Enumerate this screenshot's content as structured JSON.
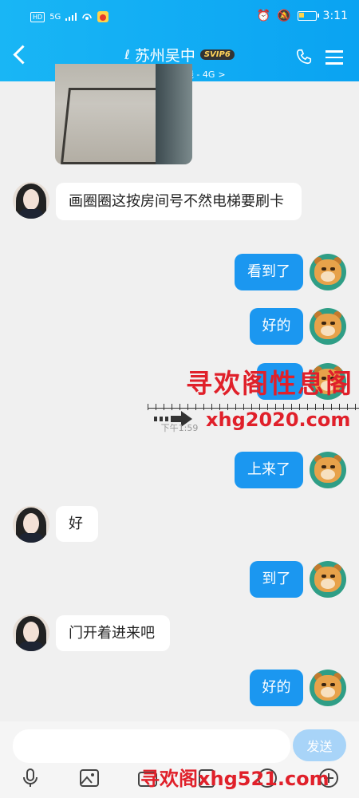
{
  "status_bar": {
    "left_badges": [
      "HD",
      "5G"
    ],
    "time": "3:11"
  },
  "header": {
    "title": "苏州吴中",
    "vip_badge": "SVIP6",
    "subtitle": "TIM移动在线 - 4G",
    "subtitle_arrow": ">",
    "icons": [
      "back-icon",
      "ear-icon",
      "phone-icon",
      "menu-icon"
    ]
  },
  "messages": [
    {
      "side": "left",
      "text": "画圈圈这按房间号不然电梯要刷卡"
    },
    {
      "side": "right",
      "text": "看到了"
    },
    {
      "side": "right",
      "text": "好的"
    },
    {
      "side": "right",
      "text": ""
    },
    {
      "side": "right",
      "text": "上来了"
    },
    {
      "side": "left",
      "text": "好"
    },
    {
      "side": "right",
      "text": "到了"
    },
    {
      "side": "left",
      "text": "门开着进来吧"
    },
    {
      "side": "right",
      "text": "好的"
    }
  ],
  "timestamp": "下午1:59",
  "watermark": {
    "top_text": "寻欢阁性息阁",
    "url_text": "xhg2020.com",
    "bottom_text": "寻欢阁xhg521.com",
    "color": "#e0202a"
  },
  "input_bar": {
    "placeholder": "",
    "send_label": "发送",
    "toolbar_icons": [
      "microphone-icon",
      "image-icon",
      "camera-icon",
      "file-icon",
      "emoji-icon",
      "plus-icon"
    ]
  },
  "colors": {
    "header": "#0aa3f2",
    "bubble_right": "#1b97f0",
    "send_button": "#a8d4f8"
  }
}
